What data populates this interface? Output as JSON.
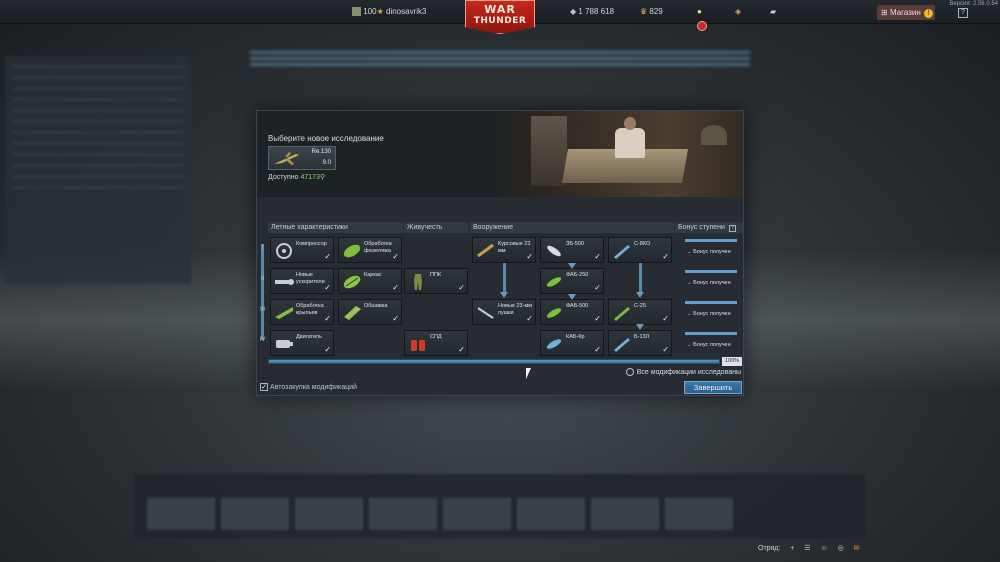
{
  "topbar": {
    "rank": "100",
    "username": "dinosavrik3",
    "logo_line1": "WAR",
    "logo_line2": "THUNDER",
    "silver_lions": "1 788 618",
    "golden_eagles": "829",
    "shop_label": "Магазин",
    "shop_badge": "!",
    "help_label": "?",
    "version": "Версия: 2.56.0.54"
  },
  "modal": {
    "title": "Выберите новое исследование",
    "unit": {
      "name": "Re.130",
      "br": "9.0"
    },
    "available_label": "Доступно",
    "available_value": "47173",
    "columns": {
      "flight": "Летные характеристики",
      "survivability": "Живучесть",
      "armament": "Вооружение",
      "bonus": "Бонус ступени"
    },
    "tiers": [
      "I",
      "II",
      "III",
      "IV"
    ],
    "mods": {
      "compressor": "Компрессор",
      "fuselage": "Обработка фюзеляжа",
      "boosters": "Новые ускорители",
      "frame": "Каркас",
      "wings": "Обработка крыльев",
      "skin": "Обшивка",
      "engine": "Двигатель",
      "ppk": "ППК",
      "spd": "СПД",
      "gun23": "Курсовые 23 мм",
      "new_gun23": "Новые 23-мм пушки",
      "zb500": "ЗБ-500",
      "fab250": "ФАБ-250",
      "fab500": "ФАБ-500",
      "kab": "КАБ-Кр",
      "s8ko": "С-8КО",
      "s25": "С-25",
      "b13l": "Б-13Л"
    },
    "bonus_text": "Бонус получен",
    "progress_percent": "100%",
    "progress_value": 1.0,
    "all_researched": "Все модификации исследованы",
    "autobuy": "Автозакупка модификаций",
    "finish": "Завершить"
  },
  "bottom": {
    "squad": "Отряд:"
  }
}
